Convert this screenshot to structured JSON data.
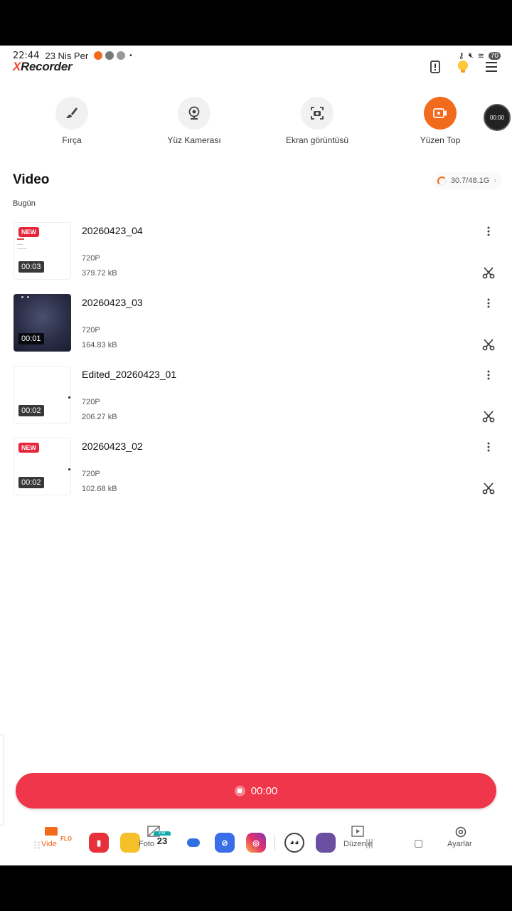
{
  "status_bar": {
    "time": "22:44",
    "date": "23 Nis Per",
    "battery": "70"
  },
  "app": {
    "logo_x": "X",
    "logo_rest": "Recorder"
  },
  "tools": [
    {
      "label": "Fırça",
      "icon": "brush-icon"
    },
    {
      "label": "Yüz Kamerası",
      "icon": "webcam-icon"
    },
    {
      "label": "Ekran görüntüsü",
      "icon": "screenshot-icon"
    },
    {
      "label": "Yüzen Top",
      "icon": "floating-ball-icon"
    }
  ],
  "floating_ball": {
    "time": "00:00"
  },
  "section": {
    "title": "Video",
    "date_group": "Bugün"
  },
  "storage": {
    "text": "30.7/48.1G"
  },
  "videos": [
    {
      "title": "20260423_04",
      "resolution": "720P",
      "size": "379.72 kB",
      "duration": "00:03",
      "new": "NEW"
    },
    {
      "title": "20260423_03",
      "resolution": "720P",
      "size": "164.83 kB",
      "duration": "00:01",
      "new": ""
    },
    {
      "title": "Edited_20260423_01",
      "resolution": "720P",
      "size": "206.27 kB",
      "duration": "00:02",
      "new": ""
    },
    {
      "title": "20260423_02",
      "resolution": "720P",
      "size": "102.68 kB",
      "duration": "00:02",
      "new": "NEW"
    }
  ],
  "record": {
    "time": "00:00"
  },
  "bottom_tabs": {
    "video": "Vide",
    "photo": "Foto",
    "edit": "Düzenle",
    "settings": "Ayarlar",
    "calendar_day": "23",
    "calendar_tag": "Per",
    "flo": "FLO"
  },
  "colors": {
    "accent": "#f0364a",
    "orange": "#f26a1b",
    "new_badge": "#e8243a"
  }
}
